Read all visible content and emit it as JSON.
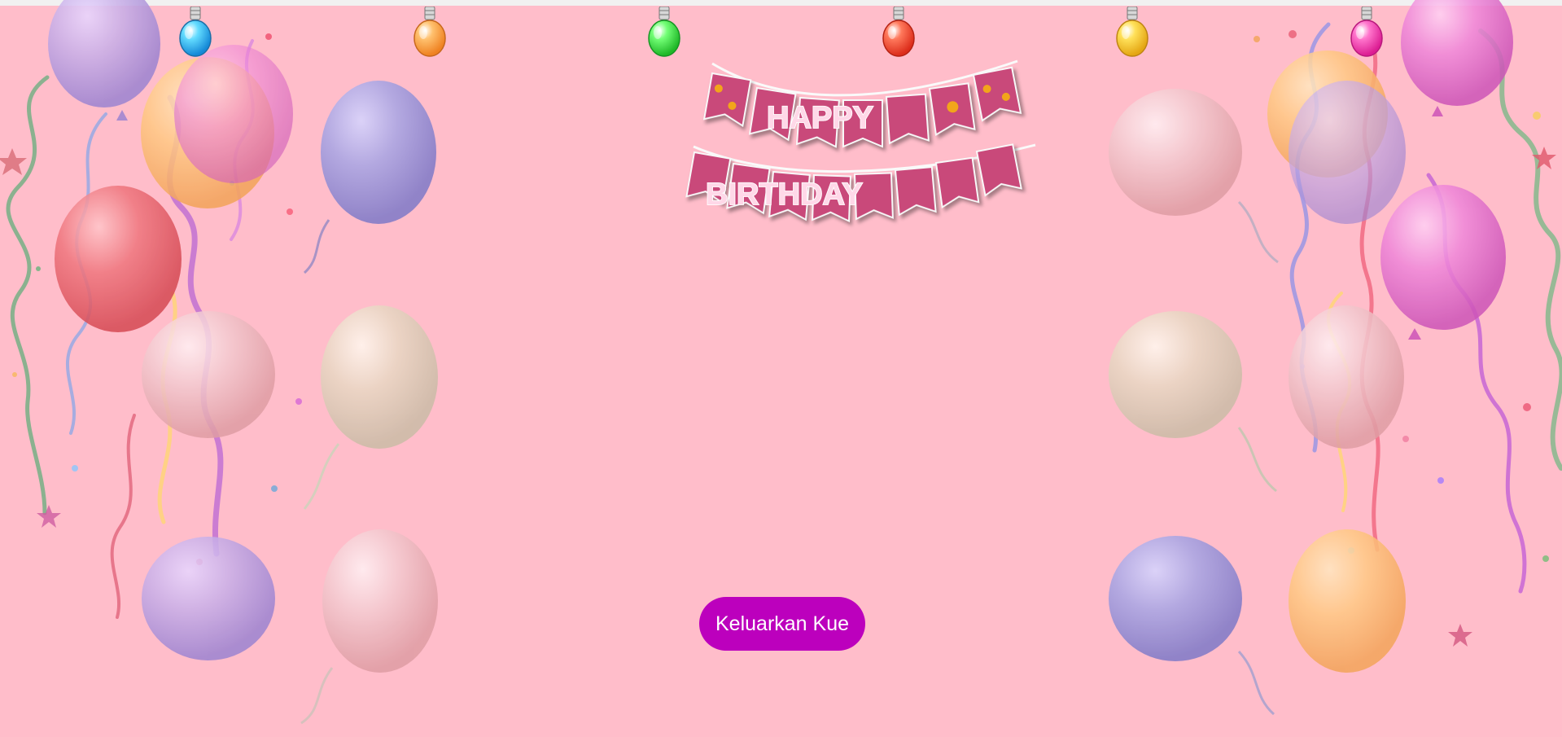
{
  "app": {
    "button_label": "Keluarkan Kue"
  },
  "banner": {
    "line_one": "HAPPY",
    "line_two": "BIRTHDAY"
  },
  "icons": {
    "bulbs": [
      "blue-bulb-icon",
      "orange-bulb-icon",
      "green-bulb-icon",
      "red-bulb-icon",
      "yellow-bulb-icon",
      "pink-bulb-icon"
    ],
    "decorations": [
      "balloon-icon",
      "confetti-icon",
      "ribbon-icon",
      "banner-icon"
    ]
  },
  "colors": {
    "background": "#ffbdca",
    "button": "#bc00bd",
    "button_text": "#ffffff"
  }
}
